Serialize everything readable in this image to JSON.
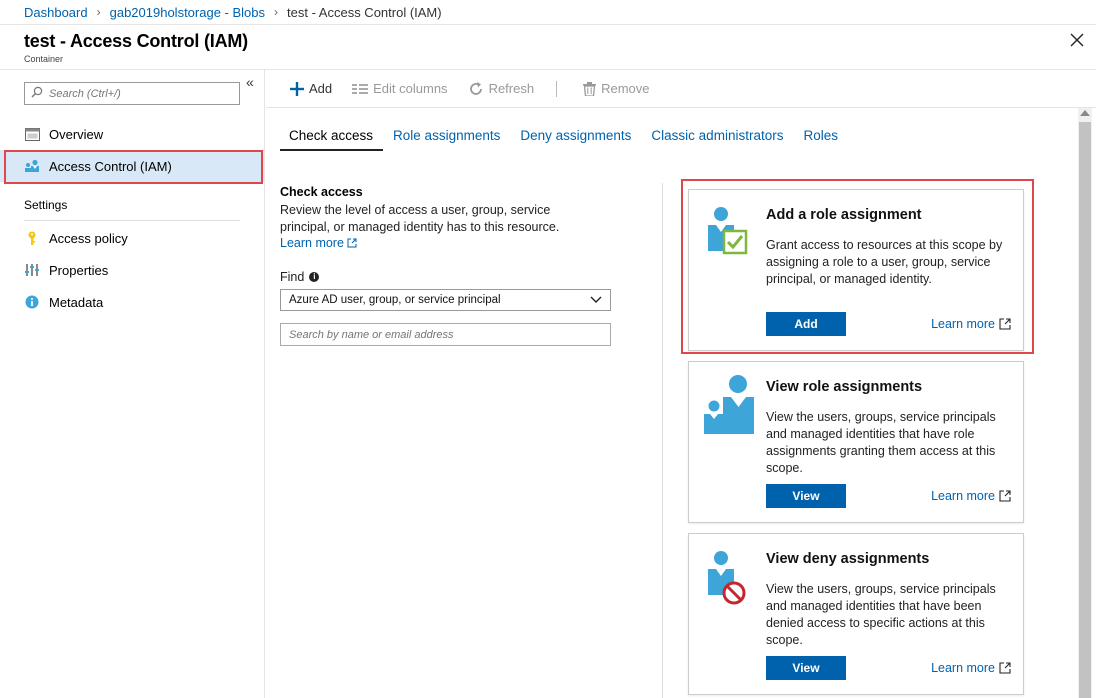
{
  "breadcrumb": {
    "items": [
      "Dashboard",
      "gab2019holstorage - Blobs"
    ],
    "current": "test - Access Control (IAM)"
  },
  "header": {
    "title": "test - Access Control (IAM)",
    "subtitle": "Container"
  },
  "sidebar": {
    "search_placeholder": "Search (Ctrl+/)",
    "items": [
      {
        "label": "Overview",
        "icon": "overview-icon"
      },
      {
        "label": "Access Control (IAM)",
        "icon": "iam-icon",
        "selected": true
      }
    ],
    "section": "Settings",
    "settings_items": [
      {
        "label": "Access policy",
        "icon": "key-icon"
      },
      {
        "label": "Properties",
        "icon": "properties-icon"
      },
      {
        "label": "Metadata",
        "icon": "info-icon"
      }
    ]
  },
  "toolbar": {
    "add": "Add",
    "edit_columns": "Edit columns",
    "refresh": "Refresh",
    "remove": "Remove"
  },
  "tabs": [
    "Check access",
    "Role assignments",
    "Deny assignments",
    "Classic administrators",
    "Roles"
  ],
  "check_access": {
    "title": "Check access",
    "description": "Review the level of access a user, group, service principal, or managed identity has to this resource.",
    "learn_more": "Learn more",
    "find_label": "Find",
    "find_value": "Azure AD user, group, or service principal",
    "search_placeholder": "Search by name or email address"
  },
  "cards": [
    {
      "title": "Add a role assignment",
      "description": "Grant access to resources at this scope by assigning a role to a user, group, service principal, or managed identity.",
      "button": "Add",
      "link": "Learn more"
    },
    {
      "title": "View role assignments",
      "description": "View the users, groups, service principals and managed identities that have role assignments granting them access at this scope.",
      "button": "View",
      "link": "Learn more"
    },
    {
      "title": "View deny assignments",
      "description": "View the users, groups, service principals and managed identities that have been denied access to specific actions at this scope.",
      "button": "View",
      "link": "Learn more"
    }
  ],
  "colors": {
    "link": "#0062ad",
    "primary_button": "#0062ad",
    "highlight": "#e0474c",
    "selected_bg": "#d8e8f7",
    "person_icon": "#3ea5d8",
    "check_green": "#7db83c",
    "deny_red": "#c4262e"
  }
}
